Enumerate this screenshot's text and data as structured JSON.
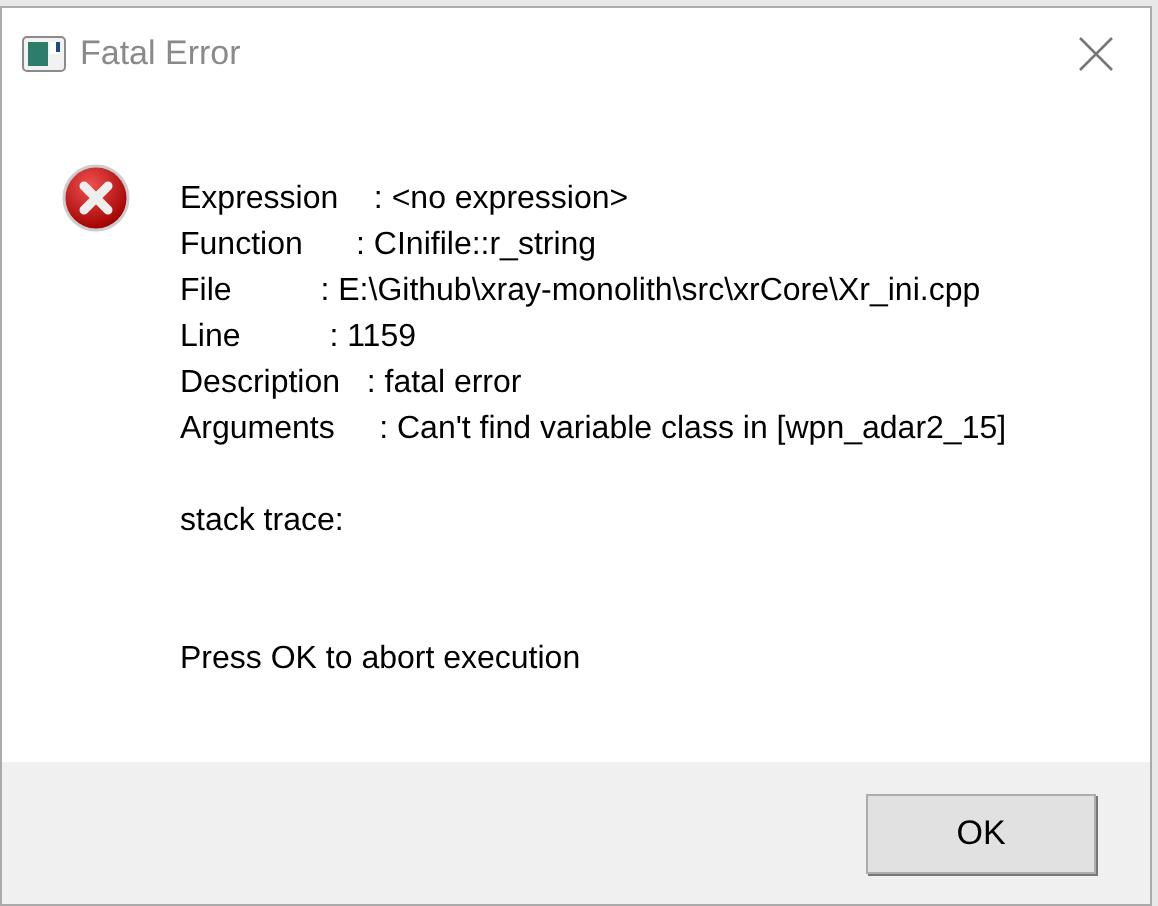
{
  "window": {
    "title": "Fatal Error"
  },
  "message": {
    "lines": [
      "Expression    : <no expression>",
      "Function      : CInifile::r_string",
      "File          : E:\\Github\\xray-monolith\\src\\xrCore\\Xr_ini.cpp",
      "Line          : 1159",
      "Description   : fatal error",
      "Arguments     : Can't find variable class in [wpn_adar2_15]"
    ],
    "stack_label": "stack trace:",
    "prompt": "Press OK to abort execution"
  },
  "buttons": [
    "OK"
  ]
}
